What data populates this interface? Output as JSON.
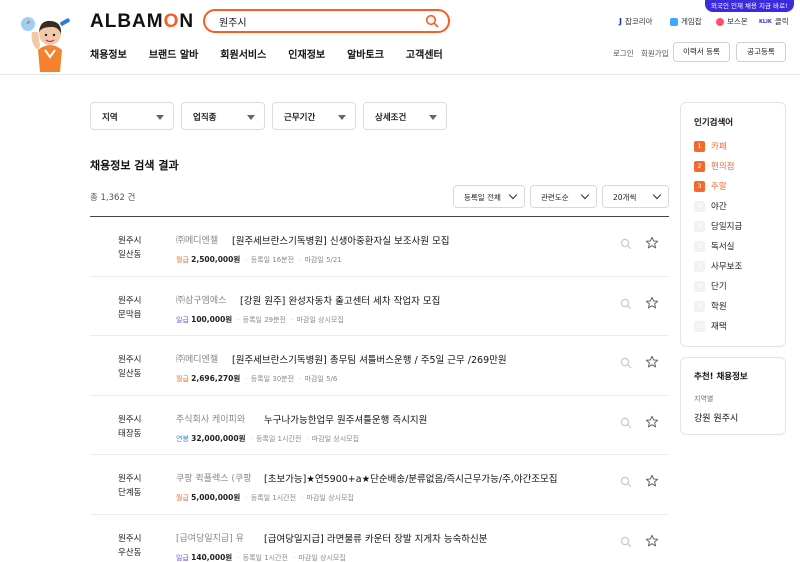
{
  "brand": {
    "logo_before": "ALBAM",
    "logo_o": "O",
    "logo_after": "N",
    "accent": "#ff5a1f"
  },
  "search": {
    "value": "원주시"
  },
  "promo_badge": "외국인 인재 채용 지금 바로!",
  "family_sites": [
    {
      "label": "잡코리아",
      "icon": "jobkorea-icon",
      "color": "#1d2bd8"
    },
    {
      "label": "게임잡",
      "icon": "gamejob-icon",
      "color": "#3fa7ff"
    },
    {
      "label": "보스몬",
      "icon": "bossmon-icon",
      "color": "#ff4d6a"
    },
    {
      "label": "클릭",
      "icon": "klik-icon",
      "color": "#2b2bdc"
    }
  ],
  "gnb": [
    "채용정보",
    "브랜드 알바",
    "회원서비스",
    "인재정보",
    "알바토크",
    "고객센터"
  ],
  "util": {
    "login": "로그인",
    "join": "회원가입",
    "resume_btn": "이력서 등록",
    "post_btn": "공고등록"
  },
  "filters": [
    "지역",
    "업직종",
    "근무기간",
    "상세조건"
  ],
  "results": {
    "title": "채용정보 검색 결과",
    "total": "총 1,362 건"
  },
  "sort": {
    "date": "등록일 전체",
    "relevance": "관련도순",
    "per_page": "20개씩"
  },
  "jobs": [
    {
      "loc1": "원주시",
      "loc2": "일산동",
      "company": "㈜메디엔젤",
      "title": "[원주세브란스기독병원] 신생아중환자실 보조사원 모집",
      "wage_type": "월급",
      "wage_color": "#f46a2e",
      "wage": "2,500,000원",
      "posted": "등록일 16분전",
      "deadline": "마감일 5/21"
    },
    {
      "loc1": "원주시",
      "loc2": "문막읍",
      "company": "㈜삼구엠에스",
      "title": "[강원 원주] 완성자동차 출고센터 세차 작업자 모집",
      "wage_type": "일급",
      "wage_color": "#7b4de0",
      "wage": "100,000원",
      "posted": "등록일 29분전",
      "deadline": "마감일 상시모집"
    },
    {
      "loc1": "원주시",
      "loc2": "일산동",
      "company": "㈜메디엔젤",
      "title": "[원주세브란스기독병원] 총무팀 셔틀버스운행 / 주5일 근무 /269만원",
      "wage_type": "월급",
      "wage_color": "#f46a2e",
      "wage": "2,696,270원",
      "posted": "등록일 30분전",
      "deadline": "마감일 5/6"
    },
    {
      "loc1": "원주시",
      "loc2": "태장동",
      "company": "주식회사 케이피와",
      "title": "누구나가능한업무 원주셔틀운행 즉시지원",
      "wage_type": "연봉",
      "wage_color": "#1f9ad6",
      "wage": "32,000,000원",
      "posted": "등록일 1시간전",
      "deadline": "마감일 상시모집"
    },
    {
      "loc1": "원주시",
      "loc2": "단계동",
      "company": "쿠팡 퀵플렉스 (쿠팡",
      "title": "[초보가능]★연5900+a★단순배송/분류없음/즉시근무가능/주,야간조모집",
      "wage_type": "월급",
      "wage_color": "#f46a2e",
      "wage": "5,000,000원",
      "posted": "등록일 1시간전",
      "deadline": "마감일 상시모집"
    },
    {
      "loc1": "원주시",
      "loc2": "우산동",
      "company": "[급여당일지급] 유",
      "title": "[급여당일지급] 라면물류 카운터 장발 지게차 능숙하신분",
      "wage_type": "일급",
      "wage_color": "#7b4de0",
      "wage": "140,000원",
      "posted": "등록일 1시간전",
      "deadline": "마감일 상시모집"
    }
  ],
  "popular": {
    "title": "인기검색어",
    "items": [
      "카페",
      "편의점",
      "주말",
      "야간",
      "당일지급",
      "독서실",
      "사무보조",
      "단기",
      "학원",
      "재택"
    ]
  },
  "recommend": {
    "title": "추천! 채용정보",
    "label": "지역별",
    "value": "강원 원주시"
  }
}
